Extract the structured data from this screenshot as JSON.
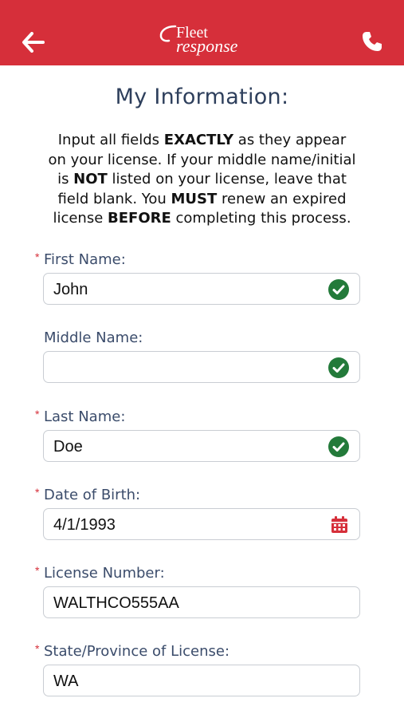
{
  "header": {
    "logo_line1": "Fleet",
    "logo_line2": "response",
    "brand_color": "#d62f3a"
  },
  "page": {
    "title": "My Information:",
    "instructions": [
      {
        "t": "Input all fields ",
        "b": false
      },
      {
        "t": "EXACTLY",
        "b": true
      },
      {
        "t": " as they appear on your license. If your middle name/initial is ",
        "b": false
      },
      {
        "t": "NOT",
        "b": true
      },
      {
        "t": " listed on your license, leave that field blank. You ",
        "b": false
      },
      {
        "t": "MUST",
        "b": true
      },
      {
        "t": " renew an expired license ",
        "b": false
      },
      {
        "t": "BEFORE",
        "b": true
      },
      {
        "t": " completing this process.",
        "b": false
      }
    ]
  },
  "fields": {
    "first_name": {
      "label": "First Name:",
      "value": "John",
      "required": "*"
    },
    "middle_name": {
      "label": "Middle Name:",
      "value": ""
    },
    "last_name": {
      "label": "Last Name:",
      "value": "Doe",
      "required": "*"
    },
    "dob": {
      "label": "Date of Birth:",
      "value": "4/1/1993",
      "required": "*"
    },
    "license": {
      "label": "License Number:",
      "value": "WALTHCO555AA",
      "required": "*"
    },
    "state": {
      "label": "State/Province of License:",
      "value": "WA",
      "required": "*"
    }
  },
  "icons": {
    "back": "arrow-left-icon",
    "phone": "phone-icon",
    "valid": "check-circle-icon",
    "calendar": "calendar-icon"
  },
  "colors": {
    "valid_green": "#237a3a",
    "calendar_red": "#d62f3a",
    "label_blue": "#3b4c6b"
  }
}
